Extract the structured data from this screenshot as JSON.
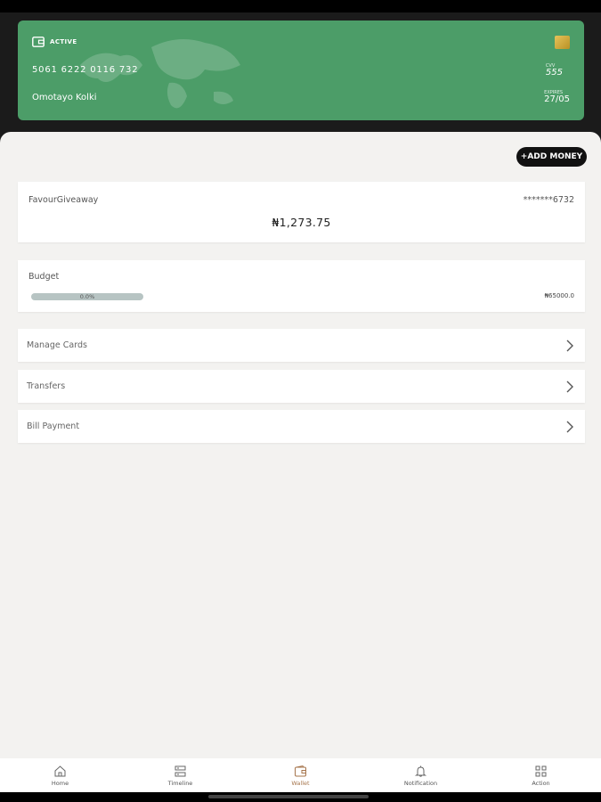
{
  "card": {
    "status": "ACTIVE",
    "number": "5061  6222  0116  732",
    "holder": "Omotayo Kolki",
    "cvv_label": "CVV",
    "cvv": "555",
    "expiry_label": "EXPIRES",
    "expiry": "27/05",
    "color": "#4c9d68"
  },
  "actions": {
    "add_money": "+ADD MONEY"
  },
  "account": {
    "name": "FavourGiveaway",
    "masked_number": "*******6732",
    "balance": "₦1,273.75"
  },
  "budget": {
    "label": "Budget",
    "percent_text": "0.0%",
    "progress": 0.0,
    "limit": "₦65000.0"
  },
  "menu": [
    {
      "label": "Manage Cards"
    },
    {
      "label": "Transfers"
    },
    {
      "label": "Bill Payment"
    }
  ],
  "nav": [
    {
      "label": "Home",
      "icon": "home-icon"
    },
    {
      "label": "Timeline",
      "icon": "timeline-icon"
    },
    {
      "label": "Wallet",
      "icon": "wallet-icon",
      "active": true
    },
    {
      "label": "Notification",
      "icon": "bell-icon"
    },
    {
      "label": "Action",
      "icon": "grid-icon"
    }
  ],
  "colors": {
    "accent": "#a5744b",
    "sheet_bg": "#f3f2f0",
    "button_bg": "#111111"
  }
}
